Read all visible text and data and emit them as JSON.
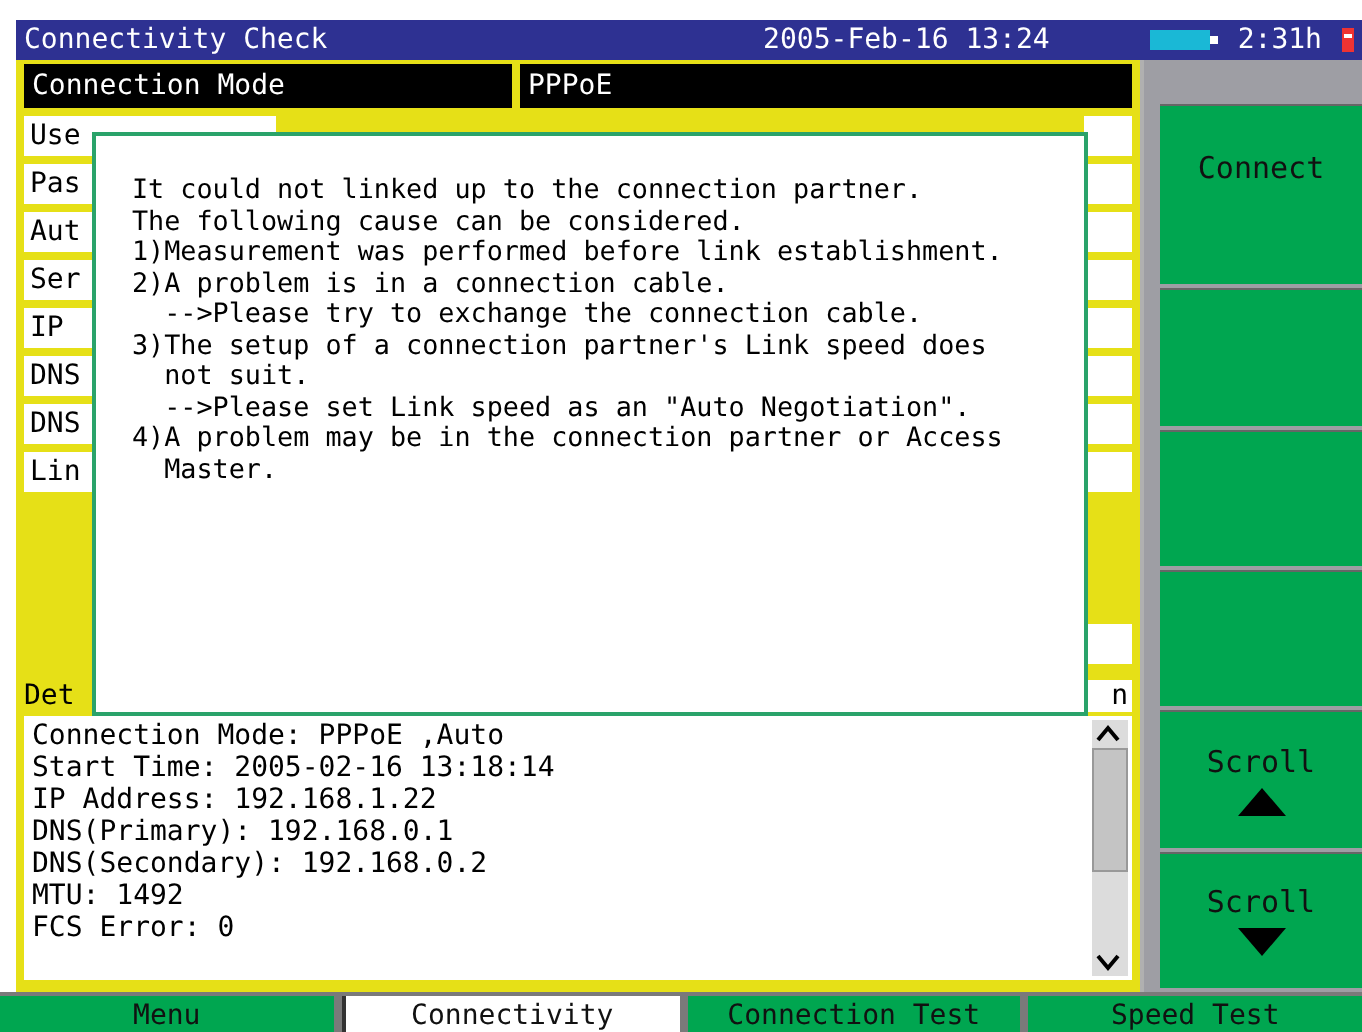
{
  "title_bar": {
    "title": "Connectivity Check",
    "datetime": "2005-Feb-16 13:24",
    "battery_time": "2:31h"
  },
  "header": {
    "label": "Connection Mode",
    "value": "PPPoE"
  },
  "fields": [
    {
      "label": "Use"
    },
    {
      "label": "Pas"
    },
    {
      "label": "Aut"
    },
    {
      "label": "Ser"
    },
    {
      "label": "IP"
    },
    {
      "label": "DNS"
    },
    {
      "label": "DNS"
    },
    {
      "label": "Lin"
    }
  ],
  "detail": {
    "label": "Det",
    "value": "n"
  },
  "log": [
    "Connection Mode: PPPoE ,Auto",
    "Start Time: 2005-02-16 13:18:14",
    "IP Address: 192.168.1.22",
    "DNS(Primary): 192.168.0.1",
    "DNS(Secondary): 192.168.0.2",
    "MTU: 1492",
    "FCS Error: 0"
  ],
  "dialog": {
    "lines": [
      "It could not linked up to the connection partner.",
      "The following cause can be considered.",
      "1)Measurement was performed before link establishment.",
      "2)A problem is in a connection cable.",
      "  -->Please try to exchange the connection cable.",
      "3)The setup of a connection partner's Link speed does",
      "  not suit.",
      "  -->Please set Link speed as an \"Auto Negotiation\".",
      "4)A problem may be in the connection partner or Access",
      "  Master."
    ]
  },
  "softkeys": [
    {
      "kind": "text",
      "label": "Connect"
    },
    {
      "kind": "blank"
    },
    {
      "kind": "blank"
    },
    {
      "kind": "blank"
    },
    {
      "kind": "up",
      "label": "Scroll"
    },
    {
      "kind": "down",
      "label": "Scroll"
    }
  ],
  "tabs": [
    {
      "label": "Menu",
      "selected": false
    },
    {
      "label": "Connectivity",
      "selected": true
    },
    {
      "label": "Connection Test",
      "selected": false
    },
    {
      "label": "Speed Test",
      "selected": false
    }
  ]
}
